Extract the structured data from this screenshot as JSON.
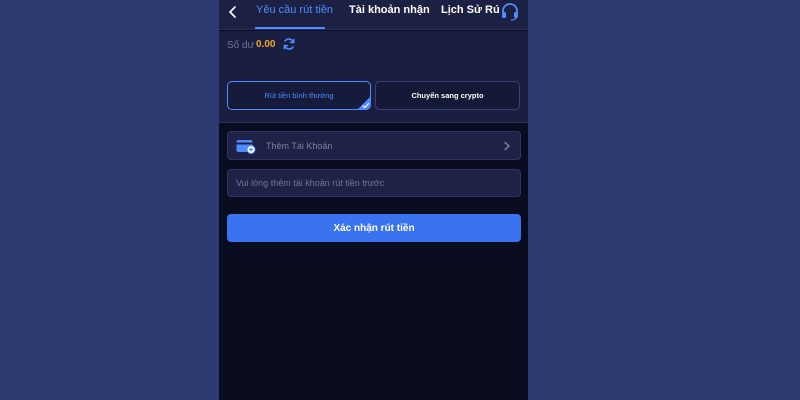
{
  "header": {
    "tabs": [
      {
        "label": "Yêu cầu rút tiền",
        "active": true
      },
      {
        "label": "Tài khoản nhận",
        "active": false
      },
      {
        "label": "Lịch Sử Rú",
        "active": false
      }
    ],
    "back_icon": "chevron-left-icon",
    "support_icon": "headset-icon"
  },
  "balance": {
    "label": "Số dư",
    "value": "0.00",
    "refresh_icon": "refresh-icon"
  },
  "methods": [
    {
      "label": "Rút tiền bình thường",
      "selected": true
    },
    {
      "label": "Chuyển sang crypto",
      "selected": false
    }
  ],
  "account": {
    "add_label": "Thêm Tài Khoản",
    "input_placeholder": "Vui lòng thêm tài khoản rút tiền trước",
    "input_value": ""
  },
  "confirm_label": "Xác nhận rút tiền",
  "colors": {
    "page_bg": "#2e3a72",
    "panel_bg": "#090b1e",
    "accent": "#4f8cff",
    "balance_value": "#f2a623",
    "primary_button": "#3a73f0"
  }
}
